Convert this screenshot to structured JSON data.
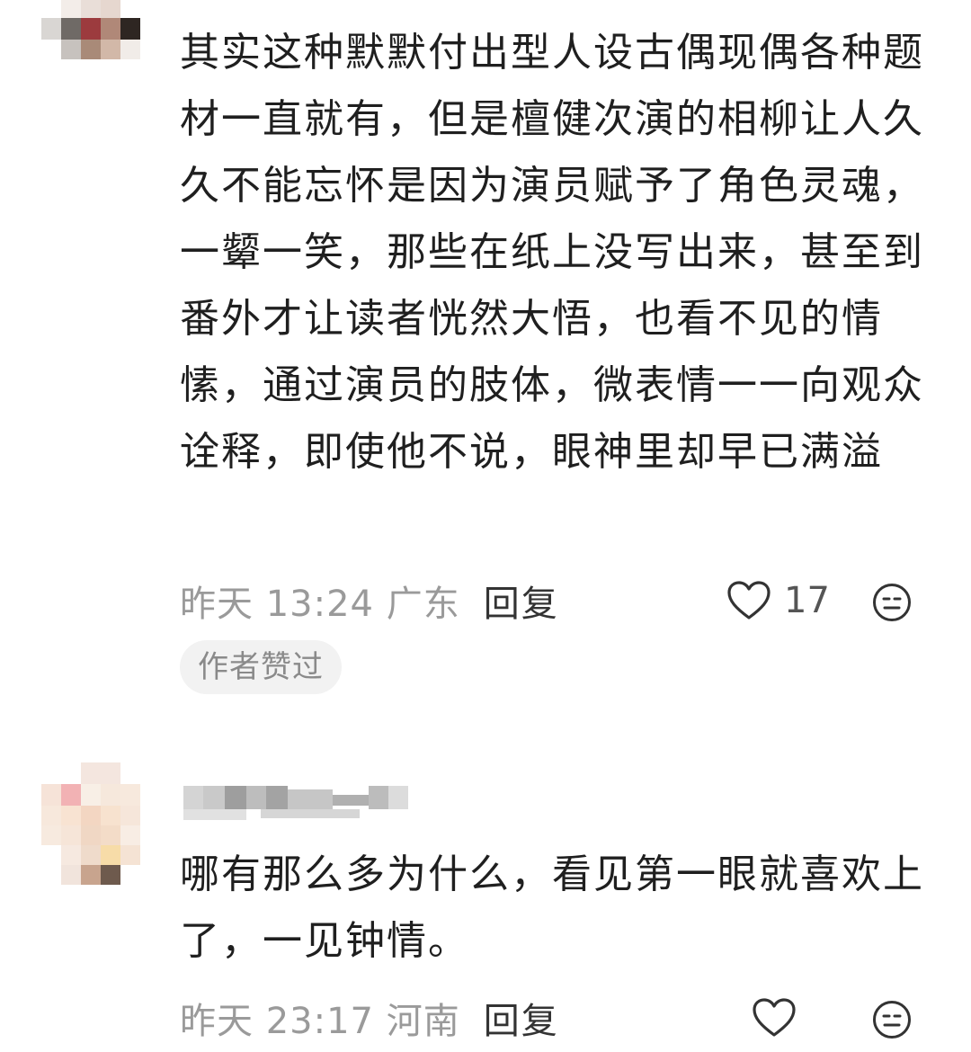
{
  "comments": [
    {
      "text": "其实这种默默付出型人设古偶现偶各种题材一直就有，但是檀健次演的相柳让人久久不能忘怀是因为演员赋予了角色灵魂，一颦一笑，那些在纸上没写出来，甚至到番外才让读者恍然大悟，也看不见的情愫，通过演员的肢体，微表情一一向观众诠释，即使他不说，眼神里却早已满溢",
      "time_location": "昨天 13:24 广东",
      "reply_label": "回复",
      "like_count": "17",
      "badge": "作者赞过",
      "icons": [
        "heart-icon",
        "neutral-face-icon"
      ]
    },
    {
      "text": "哪有那么多为什么，看见第一眼就喜欢上了，一见钟情。",
      "time_location": "昨天 23:17 河南",
      "reply_label": "回复",
      "like_count": "",
      "icons": [
        "heart-icon",
        "neutral-face-icon"
      ]
    }
  ]
}
